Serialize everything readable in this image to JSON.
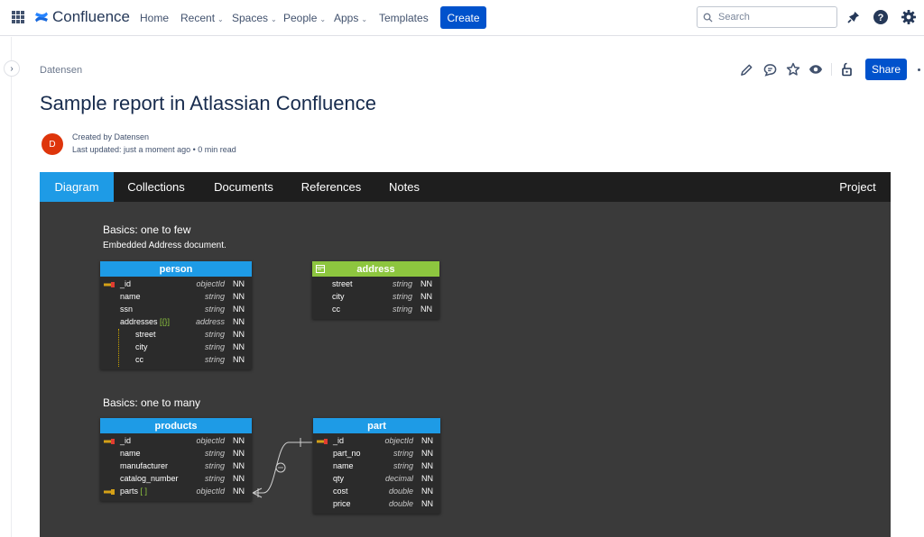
{
  "nav": {
    "logo": "Confluence",
    "items": [
      {
        "label": "Home",
        "chevron": false
      },
      {
        "label": "Recent",
        "chevron": true
      },
      {
        "label": "Spaces",
        "chevron": true
      },
      {
        "label": "People",
        "chevron": true
      },
      {
        "label": "Apps",
        "chevron": true
      },
      {
        "label": "Templates",
        "chevron": false
      }
    ],
    "create_label": "Create",
    "search_placeholder": "Search",
    "accent": "#0052cc"
  },
  "page": {
    "breadcrumb": "Datensen",
    "title": "Sample report in Atlassian Confluence",
    "avatar_initial": "D",
    "created_by": "Created by Datensen",
    "last_updated": "Last updated: just a moment ago",
    "read_time": "0 min read",
    "share_label": "Share"
  },
  "embed": {
    "tabs": [
      "Diagram",
      "Collections",
      "Documents",
      "References",
      "Notes"
    ],
    "right_tab": "Project",
    "active_tab": "Diagram",
    "sections": [
      {
        "title": "Basics: one to few",
        "subtitle": "Embedded Address document."
      },
      {
        "title": "Basics: one to many",
        "subtitle": ""
      }
    ],
    "entities": {
      "person": {
        "name": "person",
        "fields": [
          {
            "name": "_id",
            "type": "objectId",
            "nn": "NN"
          },
          {
            "name": "name",
            "type": "string",
            "nn": "NN"
          },
          {
            "name": "ssn",
            "type": "string",
            "nn": "NN"
          },
          {
            "name": "addresses",
            "bracket": "[{}]",
            "type": "address",
            "nn": "NN"
          },
          {
            "name": "street",
            "type": "string",
            "nn": "NN"
          },
          {
            "name": "city",
            "type": "string",
            "nn": "NN"
          },
          {
            "name": "cc",
            "type": "string",
            "nn": "NN"
          }
        ]
      },
      "address": {
        "name": "address",
        "fields": [
          {
            "name": "street",
            "type": "string",
            "nn": "NN"
          },
          {
            "name": "city",
            "type": "string",
            "nn": "NN"
          },
          {
            "name": "cc",
            "type": "string",
            "nn": "NN"
          }
        ]
      },
      "products": {
        "name": "products",
        "fields": [
          {
            "name": "_id",
            "type": "objectId",
            "nn": "NN"
          },
          {
            "name": "name",
            "type": "string",
            "nn": "NN"
          },
          {
            "name": "manufacturer",
            "type": "string",
            "nn": "NN"
          },
          {
            "name": "catalog_number",
            "type": "string",
            "nn": "NN"
          },
          {
            "name": "parts",
            "bracket": "[ ]",
            "type": "objectId",
            "nn": "NN"
          }
        ]
      },
      "part": {
        "name": "part",
        "fields": [
          {
            "name": "_id",
            "type": "objectId",
            "nn": "NN"
          },
          {
            "name": "part_no",
            "type": "string",
            "nn": "NN"
          },
          {
            "name": "name",
            "type": "string",
            "nn": "NN"
          },
          {
            "name": "qty",
            "type": "decimal",
            "nn": "NN"
          },
          {
            "name": "cost",
            "type": "double",
            "nn": "NN"
          },
          {
            "name": "price",
            "type": "double",
            "nn": "NN"
          }
        ]
      }
    },
    "colors": {
      "tab_active": "#1e9be6",
      "entity_blue": "#1e9be6",
      "entity_green": "#8dc63f",
      "canvas": "#3a3a3a"
    }
  }
}
